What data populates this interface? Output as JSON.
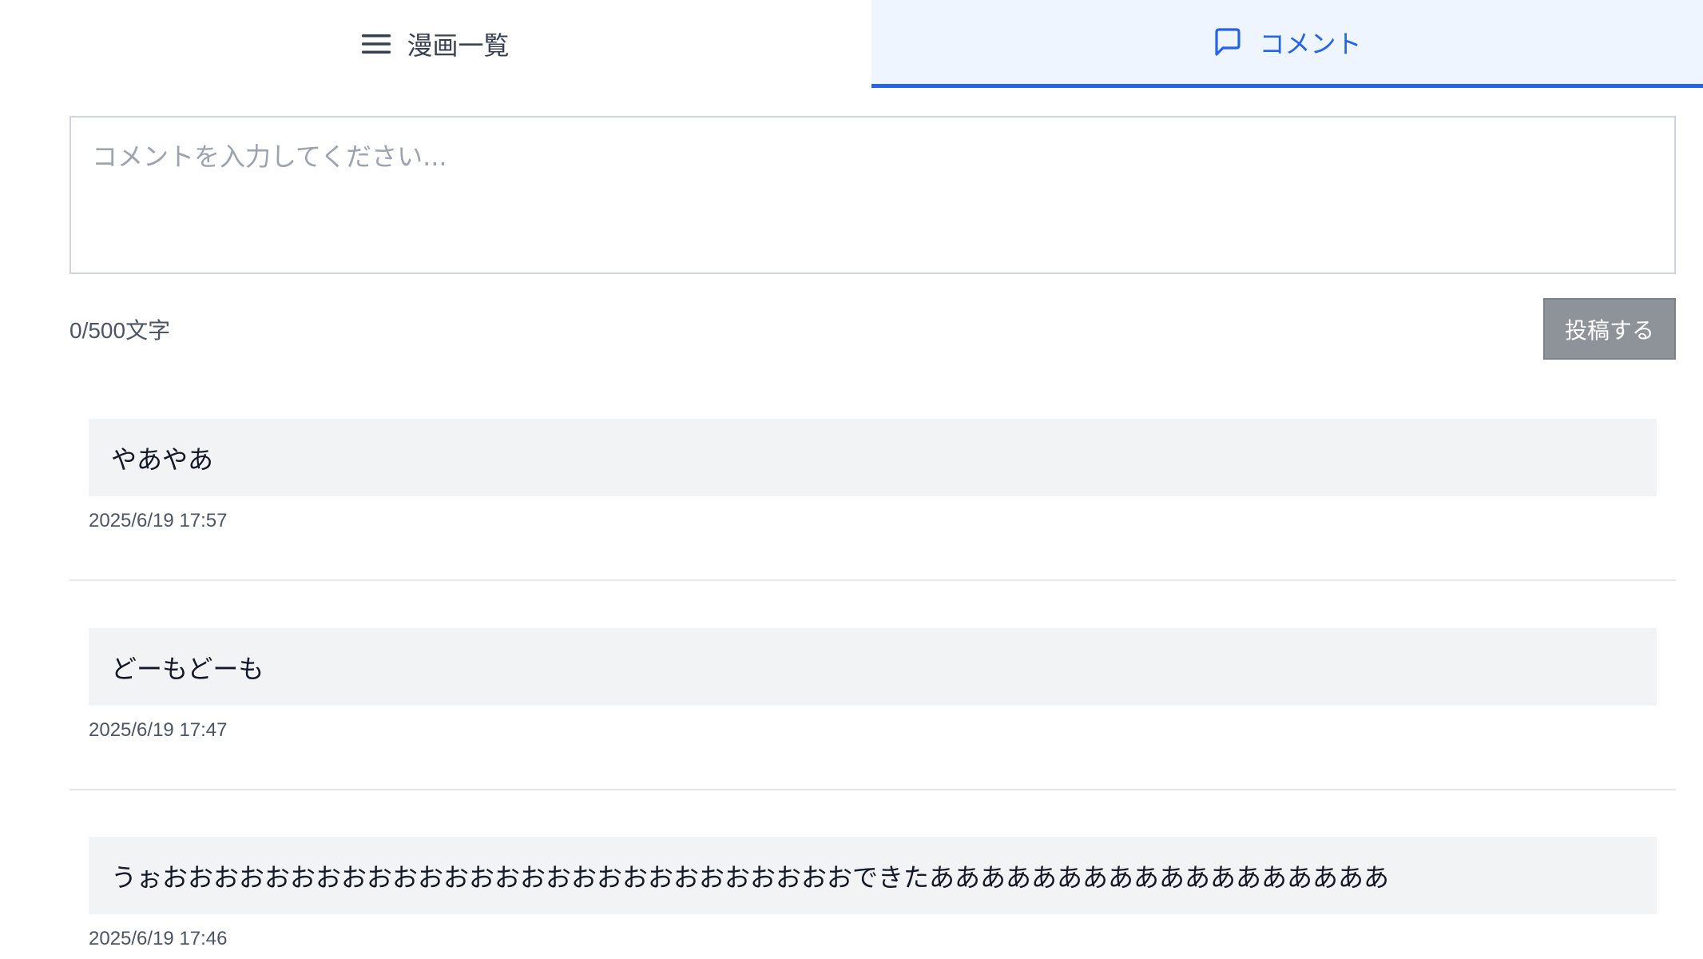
{
  "tabs": {
    "list_label": "漫画一覧",
    "comment_label": "コメント",
    "active": "comment"
  },
  "form": {
    "placeholder": "コメントを入力してください...",
    "value": "",
    "char_count": "0/500文字",
    "submit_label": "投稿する"
  },
  "comments": [
    {
      "text": "やあやあ",
      "date": "2025/6/19 17:57"
    },
    {
      "text": "どーもどーも",
      "date": "2025/6/19 17:47"
    },
    {
      "text": "うぉおおおおおおおおおおおおおおおおおおおおおおおおおおおできたああああああああああああああああああ",
      "date": "2025/6/19 17:46"
    }
  ],
  "colors": {
    "accent": "#2563eb",
    "active_tab_bg": "#eef5fe",
    "button_bg": "#8e9399",
    "comment_bg": "#f2f3f5"
  },
  "icons": {
    "list_tab": "hamburger-menu-icon",
    "comment_tab": "chat-bubble-icon"
  }
}
